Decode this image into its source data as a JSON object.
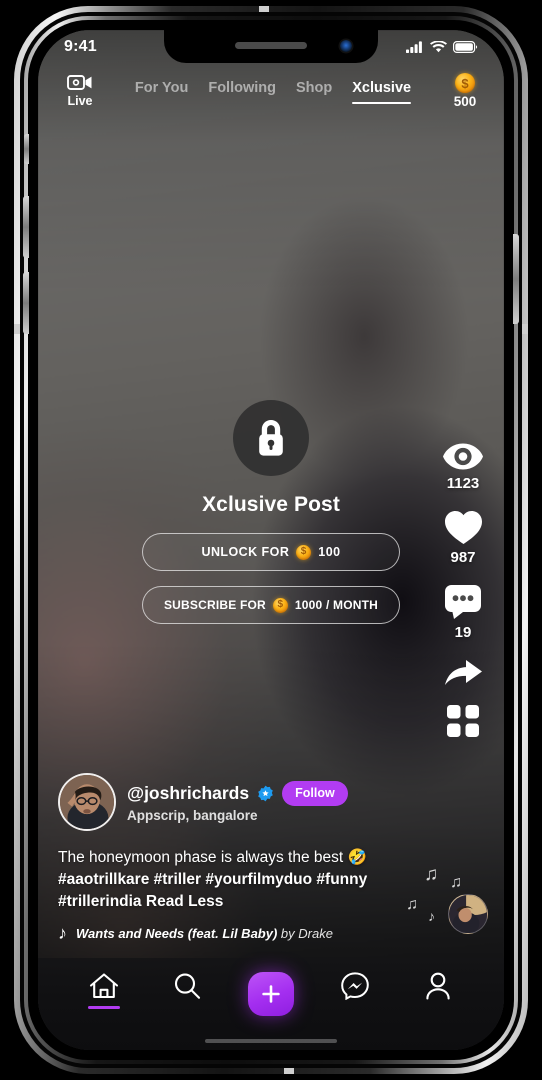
{
  "status_bar": {
    "time": "9:41",
    "icons": [
      "signal-bars-icon",
      "wifi-icon",
      "battery-icon"
    ]
  },
  "top_bar": {
    "live": {
      "label": "Live",
      "icon": "video-camera-icon"
    },
    "tabs": [
      {
        "label": "For You",
        "active": false
      },
      {
        "label": "Following",
        "active": false
      },
      {
        "label": "Shop",
        "active": false
      },
      {
        "label": "Xclusive",
        "active": true
      }
    ],
    "wallet": {
      "icon": "coin-icon",
      "balance": "500"
    }
  },
  "locked_post": {
    "lock_icon": "padlock-icon",
    "title": "Xclusive Post",
    "unlock_button": {
      "prefix": "UNLOCK FOR",
      "coin_icon": "coin-icon",
      "amount": "100"
    },
    "subscribe_button": {
      "prefix": "SUBSCRIBE FOR",
      "coin_icon": "coin-icon",
      "amount": "1000 / MONTH"
    }
  },
  "action_rail": [
    {
      "name": "views",
      "icon": "eye-icon",
      "count": "1123"
    },
    {
      "name": "likes",
      "icon": "heart-icon",
      "count": "987"
    },
    {
      "name": "comments",
      "icon": "comment-bubble-icon",
      "count": "19"
    },
    {
      "name": "share",
      "icon": "share-arrow-icon",
      "count": ""
    },
    {
      "name": "more",
      "icon": "grid-apps-icon",
      "count": ""
    }
  ],
  "post": {
    "author": {
      "handle": "@joshrichards",
      "verified_icon": "verified-badge-icon",
      "location": "Appscrip, bangalore",
      "avatar": "user-avatar"
    },
    "follow_label": "Follow",
    "caption_text": "The honeymoon phase is always the best 🤣",
    "caption_hashtags": "#aaotrillkare #triller #yourfilmyduo #funny #trillerindia",
    "caption_toggle": "Read Less",
    "music": {
      "note_icon": "music-note-icon",
      "title": "Wants and Needs (feat. Lil Baby)",
      "artist": "by Drake"
    }
  },
  "bottom_nav": [
    {
      "label": "home",
      "icon": "home-icon",
      "active": true
    },
    {
      "label": "search",
      "icon": "search-icon",
      "active": false
    },
    {
      "label": "create",
      "icon": "plus-icon",
      "active": false
    },
    {
      "label": "messages",
      "icon": "messenger-icon",
      "active": false
    },
    {
      "label": "profile",
      "icon": "person-icon",
      "active": false
    }
  ],
  "colors": {
    "accent_purple": "#b23cf2",
    "coin_gold": "#fcb316",
    "verified_blue": "#1d9bf0",
    "text_primary": "#ffffff"
  }
}
